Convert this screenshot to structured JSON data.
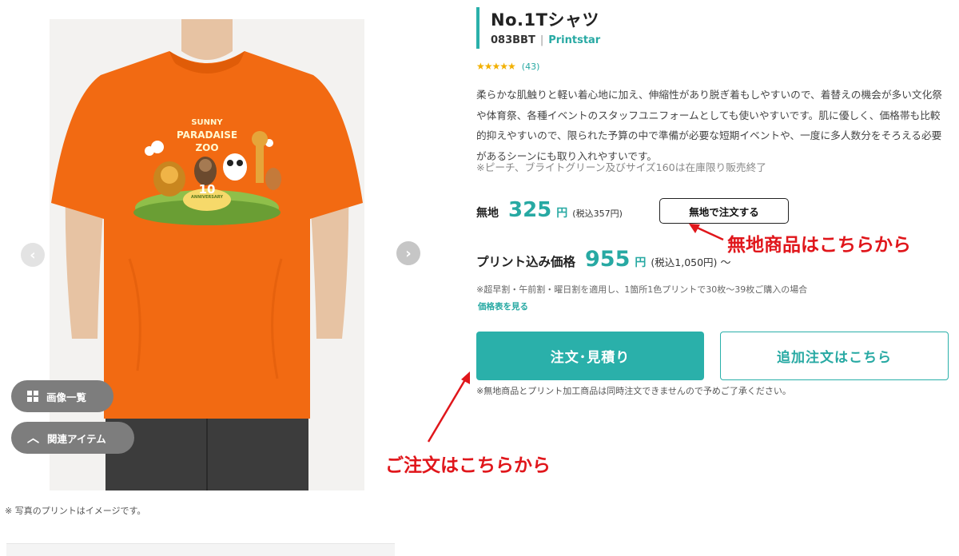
{
  "product": {
    "title": "No.1Tシャツ",
    "code": "083BBT",
    "separator": "|",
    "brand": "Printstar",
    "stars": "★★★★★",
    "review_count": "(43)",
    "rating": 5,
    "description": "柔らかな肌触りと軽い着心地に加え、伸縮性があり脱ぎ着もしやすいので、着替えの機会が多い文化祭や体育祭、各種イベントのスタッフユニフォームとしても使いやすいです。肌に優しく、価格帯も比較的抑えやすいので、限られた予算の中で準備が必要な短期イベントや、一度に多人数分をそろえる必要があるシーンにも取り入れやすいです。",
    "stock_note": "※ピーチ、ブライトグリーン及びサイズ160は在庫限り販売終了"
  },
  "image": {
    "print_line1": "SUNNY",
    "print_line2": "PARADAISE",
    "print_line3": "ZOO",
    "anniversary": "10",
    "anniversary_sub": "ANNIVERSARY",
    "gallery_label": "画像一覧",
    "related_label": "関連アイテム",
    "photo_note": "※ 写真のプリントはイメージです。"
  },
  "pricing": {
    "plain_label": "無地",
    "plain_price": "325",
    "yen": "円",
    "plain_tax": "(税込357円)",
    "plain_button": "無地で注文する",
    "print_label": "プリント込み価格",
    "print_price": "955",
    "print_tax": "(税込1,050円)",
    "tilde": "～",
    "print_note": "※超早割・午前割・曜日割を適用し、1箇所1色プリントで30枚～39枚ご購入の場合",
    "price_list_link": "価格表を見る"
  },
  "actions": {
    "order_button": "注文･見積り",
    "add_order_button": "追加注文はこちら",
    "order_note": "※無地商品とプリント加工商品は同時注文できませんので予めご了承ください。"
  },
  "annotations": {
    "plain_hint": "無地商品はこちらから",
    "order_hint": "ご注文はこちらから",
    "color": "#e0161b"
  },
  "colors": {
    "accent": "#2ab0aa",
    "shirt": "#f26a12",
    "star": "#f2b000"
  }
}
